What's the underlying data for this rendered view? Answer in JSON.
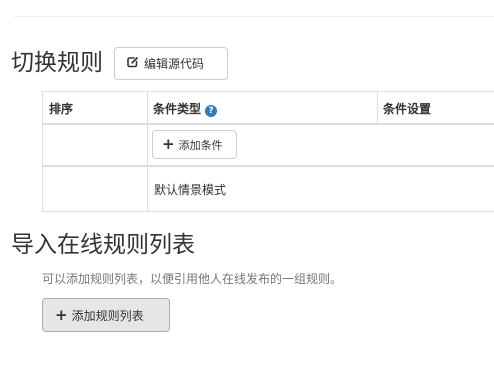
{
  "switch_rules": {
    "title": "切换规则",
    "edit_source_label": "编辑源代码",
    "table": {
      "headers": [
        "排序",
        "条件类型",
        "条件设置"
      ],
      "add_condition_label": "添加条件",
      "default_mode_label": "默认情景模式"
    }
  },
  "import_rules": {
    "title": "导入在线规则列表",
    "description": "可以添加规则列表，以便引用他人在线发布的一组规则。",
    "add_list_label": "添加规则列表"
  },
  "icons": {
    "edit": "edit-icon",
    "help": "question-circle-icon",
    "plus": "plus-icon"
  },
  "colors": {
    "help_icon": "#337ab7",
    "border": "#dddddd",
    "text": "#333333",
    "muted_text": "#777777"
  }
}
